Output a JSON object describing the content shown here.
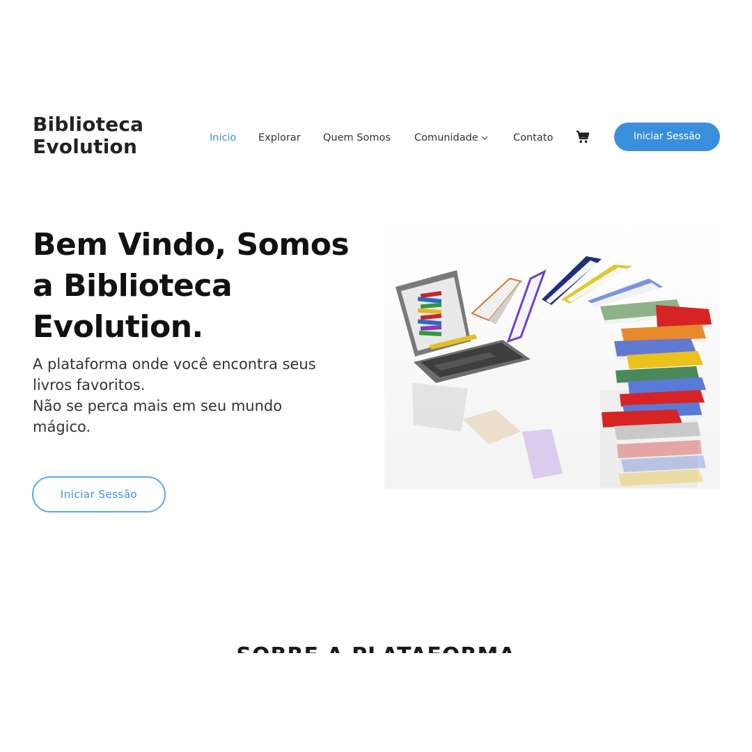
{
  "brand": {
    "line1": "Biblioteca",
    "line2": "Evolution"
  },
  "nav": {
    "items": [
      {
        "label": "Inicio",
        "active": true
      },
      {
        "label": "Explorar",
        "active": false
      },
      {
        "label": "Quem Somos",
        "active": false
      },
      {
        "label": "Comunidade",
        "active": false,
        "dropdown": true
      },
      {
        "label": "Contato",
        "active": false
      }
    ],
    "cart_icon": "shopping-cart-icon",
    "login_label": "Iniciar Sessão"
  },
  "hero": {
    "title_lines": [
      "Bem Vindo, Somos",
      "a Biblioteca",
      "Evolution."
    ],
    "subtitle_lines": [
      "A plataforma onde você encontra seus",
      "livros favoritos.",
      "Não se perca mais em seu mundo",
      "mágico."
    ],
    "button_label": "Iniciar Sessão",
    "image": "laptop-with-books-illustration"
  },
  "section": {
    "title": "SOBRE A PLATAFORMA"
  },
  "colors": {
    "accent": "#3a8fdc",
    "nav_active": "#3a96dd",
    "text": "#222222"
  }
}
